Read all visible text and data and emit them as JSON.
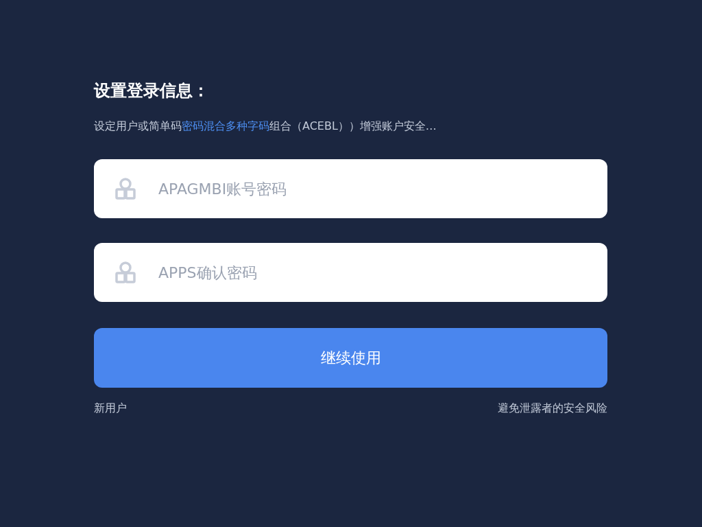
{
  "title": "设置登录信息：",
  "description": [
    {
      "text": "设定用户或简单码",
      "highlight": false
    },
    {
      "text": "密码混合多种字码",
      "highlight": true
    },
    {
      "text": "组合（ACEBL））增强账户安全…",
      "highlight": false
    }
  ],
  "fields": [
    {
      "placeholder": "APAGMBI账号密码"
    },
    {
      "placeholder": "APPS确认密码"
    }
  ],
  "submit_button": "继续使用",
  "footer": {
    "left_link": "新用户",
    "right_text": "避免泄露者的安全风险"
  }
}
